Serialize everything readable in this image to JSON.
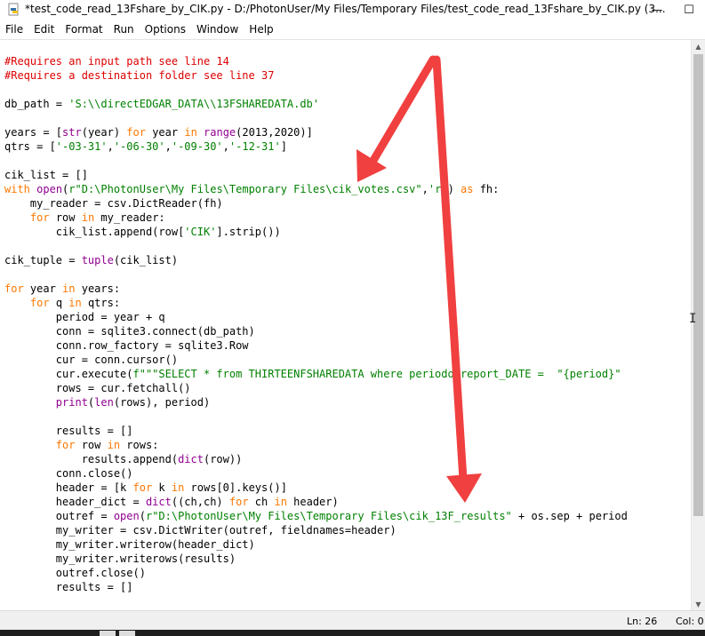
{
  "window": {
    "title": "*test_code_read_13Fshare_by_CIK.py - D:/PhotonUser/My Files/Temporary Files/test_code_read_13Fshare_by_CIK.py (3...",
    "minimize_glyph": "—",
    "maximize_glyph": "☐"
  },
  "menu": [
    "File",
    "Edit",
    "Format",
    "Run",
    "Options",
    "Window",
    "Help"
  ],
  "code_lines": [
    [
      {
        "t": "#Requires an input path see line 14",
        "c": "cm"
      }
    ],
    [
      {
        "t": "#Requires a destination folder see line 37",
        "c": "cm"
      }
    ],
    [],
    [
      {
        "t": "db_path = "
      },
      {
        "t": "'S:\\\\directEDGAR_DATA\\\\13FSHAREDATA.db'",
        "c": "st"
      }
    ],
    [],
    [
      {
        "t": "years = ["
      },
      {
        "t": "str",
        "c": "bi"
      },
      {
        "t": "(year) "
      },
      {
        "t": "for",
        "c": "kw"
      },
      {
        "t": " year "
      },
      {
        "t": "in",
        "c": "kw"
      },
      {
        "t": " "
      },
      {
        "t": "range",
        "c": "bi"
      },
      {
        "t": "(2013,2020)]"
      }
    ],
    [
      {
        "t": "qtrs = ["
      },
      {
        "t": "'-03-31'",
        "c": "st"
      },
      {
        "t": ","
      },
      {
        "t": "'-06-30'",
        "c": "st"
      },
      {
        "t": ","
      },
      {
        "t": "'-09-30'",
        "c": "st"
      },
      {
        "t": ","
      },
      {
        "t": "'-12-31'",
        "c": "st"
      },
      {
        "t": "]"
      }
    ],
    [],
    [
      {
        "t": "cik_list = []"
      }
    ],
    [
      {
        "t": "with",
        "c": "kw"
      },
      {
        "t": " "
      },
      {
        "t": "open",
        "c": "bi"
      },
      {
        "t": "("
      },
      {
        "t": "r\"D:\\PhotonUser\\My Files\\Temporary Files\\cik_votes.csv\"",
        "c": "st"
      },
      {
        "t": ","
      },
      {
        "t": "'r'",
        "c": "st"
      },
      {
        "t": ") "
      },
      {
        "t": "as",
        "c": "kw"
      },
      {
        "t": " fh:"
      }
    ],
    [
      {
        "t": "    my_reader = csv.DictReader(fh)"
      }
    ],
    [
      {
        "t": "    "
      },
      {
        "t": "for",
        "c": "kw"
      },
      {
        "t": " row "
      },
      {
        "t": "in",
        "c": "kw"
      },
      {
        "t": " my_reader:"
      }
    ],
    [
      {
        "t": "        cik_list.append(row["
      },
      {
        "t": "'CIK'",
        "c": "st"
      },
      {
        "t": "].strip())"
      }
    ],
    [],
    [
      {
        "t": "cik_tuple = "
      },
      {
        "t": "tuple",
        "c": "bi"
      },
      {
        "t": "(cik_list)"
      }
    ],
    [],
    [
      {
        "t": "for",
        "c": "kw"
      },
      {
        "t": " year "
      },
      {
        "t": "in",
        "c": "kw"
      },
      {
        "t": " years:"
      }
    ],
    [
      {
        "t": "    "
      },
      {
        "t": "for",
        "c": "kw"
      },
      {
        "t": " q "
      },
      {
        "t": "in",
        "c": "kw"
      },
      {
        "t": " qtrs:"
      }
    ],
    [
      {
        "t": "        period = year + q"
      }
    ],
    [
      {
        "t": "        conn = sqlite3.connect(db_path)"
      }
    ],
    [
      {
        "t": "        conn.row_factory = sqlite3.Row"
      }
    ],
    [
      {
        "t": "        cur = conn.cursor()"
      }
    ],
    [
      {
        "t": "        cur.execute("
      },
      {
        "t": "f\"\"\"SELECT * from THIRTEENFSHAREDATA where periodofreport_DATE =  \"{period}\" ",
        "c": "st"
      }
    ],
    [
      {
        "t": "        rows = cur.fetchall()"
      }
    ],
    [
      {
        "t": "        "
      },
      {
        "t": "print",
        "c": "bi"
      },
      {
        "t": "("
      },
      {
        "t": "len",
        "c": "bi"
      },
      {
        "t": "(rows), period)"
      }
    ],
    [],
    [
      {
        "t": "        results = []"
      }
    ],
    [
      {
        "t": "        "
      },
      {
        "t": "for",
        "c": "kw"
      },
      {
        "t": " row "
      },
      {
        "t": "in",
        "c": "kw"
      },
      {
        "t": " rows:"
      }
    ],
    [
      {
        "t": "            results.append("
      },
      {
        "t": "dict",
        "c": "bi"
      },
      {
        "t": "(row))"
      }
    ],
    [
      {
        "t": "        conn.close()"
      }
    ],
    [
      {
        "t": "        header = [k "
      },
      {
        "t": "for",
        "c": "kw"
      },
      {
        "t": " k "
      },
      {
        "t": "in",
        "c": "kw"
      },
      {
        "t": " rows[0].keys()]"
      }
    ],
    [
      {
        "t": "        header_dict = "
      },
      {
        "t": "dict",
        "c": "bi"
      },
      {
        "t": "((ch,ch) "
      },
      {
        "t": "for",
        "c": "kw"
      },
      {
        "t": " ch "
      },
      {
        "t": "in",
        "c": "kw"
      },
      {
        "t": " header)"
      }
    ],
    [
      {
        "t": "        outref = "
      },
      {
        "t": "open",
        "c": "bi"
      },
      {
        "t": "("
      },
      {
        "t": "r\"D:\\PhotonUser\\My Files\\Temporary Files\\cik_13F_results\"",
        "c": "st"
      },
      {
        "t": " + os.sep + period"
      }
    ],
    [
      {
        "t": "        my_writer = csv.DictWriter(outref, fieldnames=header)"
      }
    ],
    [
      {
        "t": "        my_writer.writerow(header_dict)"
      }
    ],
    [
      {
        "t": "        my_writer.writerows(results)"
      }
    ],
    [
      {
        "t": "        outref.close()"
      }
    ],
    [
      {
        "t": "        results = []"
      }
    ]
  ],
  "status": {
    "line": "Ln: 26",
    "col": "Col: 0"
  },
  "colors": {
    "comment": "#dd0000",
    "string": "#008000",
    "keyword": "#ff7700",
    "builtin": "#900090",
    "arrow": "#f0403f"
  }
}
